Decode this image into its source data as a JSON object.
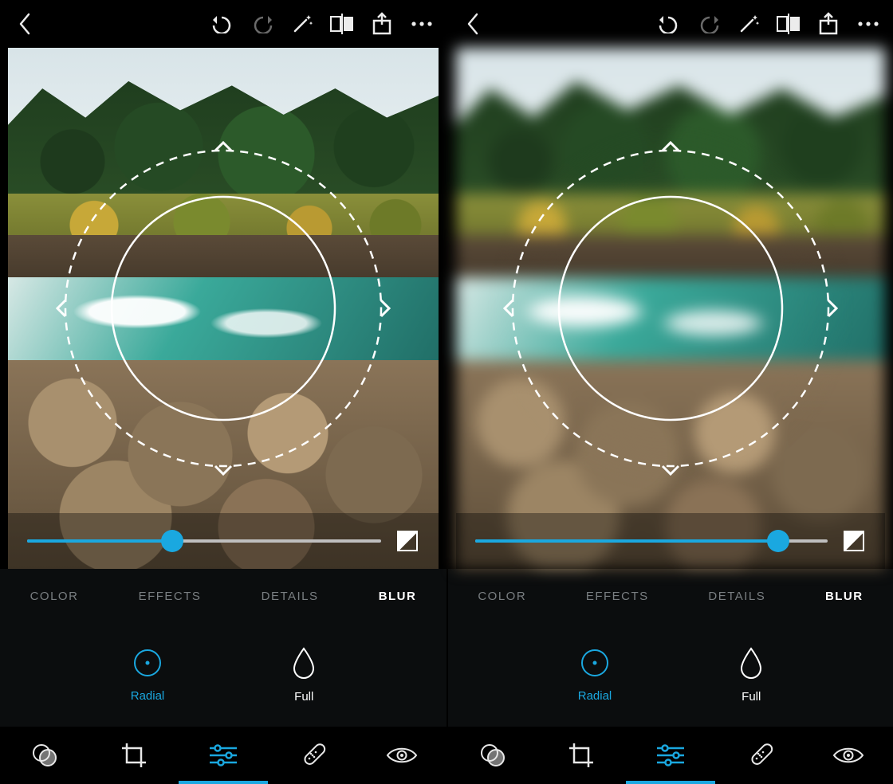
{
  "screens": [
    {
      "blur_applied": false,
      "slider": {
        "value": 41,
        "min": 0,
        "max": 100
      },
      "tabs": [
        "COLOR",
        "EFFECTS",
        "DETAILS",
        "BLUR"
      ],
      "active_tab": "BLUR",
      "options": [
        {
          "key": "radial",
          "label": "Radial",
          "active": true
        },
        {
          "key": "full",
          "label": "Full",
          "active": false
        }
      ],
      "bottom_active_index": 2
    },
    {
      "blur_applied": true,
      "slider": {
        "value": 86,
        "min": 0,
        "max": 100
      },
      "tabs": [
        "COLOR",
        "EFFECTS",
        "DETAILS",
        "BLUR"
      ],
      "active_tab": "BLUR",
      "options": [
        {
          "key": "radial",
          "label": "Radial",
          "active": true
        },
        {
          "key": "full",
          "label": "Full",
          "active": false
        }
      ],
      "bottom_active_index": 2
    }
  ],
  "topbar_icons": [
    "back",
    "undo",
    "redo",
    "auto-enhance",
    "compare-split",
    "share",
    "more"
  ],
  "bottomnav_icons": [
    "filters",
    "crop",
    "adjust",
    "heal",
    "redeye"
  ],
  "accent": "#1aa8e0"
}
